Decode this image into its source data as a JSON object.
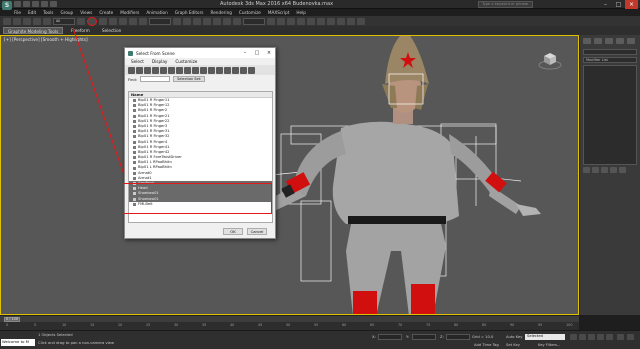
{
  "window": {
    "title": "Autodesk 3ds Max  2016 x64     Budenovka.max",
    "search_placeholder": "Type a keyword or phrase"
  },
  "menu": [
    "File",
    "Edit",
    "Tools",
    "Group",
    "Views",
    "Create",
    "Modifiers",
    "Animation",
    "Graph Editors",
    "Rendering",
    "Customize",
    "MAXScript",
    "Help"
  ],
  "toolbar": {
    "selection_filter": "All"
  },
  "ribbon": {
    "tabs": [
      "Graphite Modeling Tools",
      "Freeform",
      "Selection"
    ]
  },
  "viewport": {
    "label": "[+] [Perspective] [Smooth + Highlights]"
  },
  "command_panel": {
    "modifier_list": "Modifier List"
  },
  "dialog": {
    "title": "Select From Scene",
    "menu": [
      "Select",
      "Display",
      "Customize"
    ],
    "find_label": "Find:",
    "selection_set_label": "Selection Set:",
    "column_header": "Name",
    "items": [
      "Bip01 R Finger11",
      "Bip01 R Finger12",
      "Bip01 R Finger2",
      "Bip01 R Finger21",
      "Bip01 R Finger22",
      "Bip01 R Finger3",
      "Bip01 R Finger31",
      "Bip01 R Finger32",
      "Bip01 R Finger4",
      "Bip01 R Finger41",
      "Bip01 R Finger42",
      "Bip01 R ForeTwistDriver",
      "Bip01 L RPaoBhitn",
      "Bip01 L RPaoBhitn",
      "Armat0",
      "Armat1",
      "Armfinot",
      "Head",
      "Shoebeo01",
      "Shoebeo01",
      "FMLBelt"
    ],
    "selected_indices": [
      16,
      17,
      18,
      19
    ],
    "ok_label": "OK",
    "cancel_label": "Cancel"
  },
  "timeline": {
    "slider_label": "0 / 100",
    "ticks": [
      "0",
      "5",
      "10",
      "15",
      "20",
      "25",
      "30",
      "35",
      "40",
      "45",
      "50",
      "55",
      "60",
      "65",
      "70",
      "75",
      "80",
      "85",
      "90",
      "95",
      "100"
    ]
  },
  "status": {
    "maxscript": "Welcome to M",
    "selection_info": "1 Objects Selected",
    "prompt": "Click and drag to pan a non-camera view",
    "x_label": "X:",
    "y_label": "Y:",
    "z_label": "Z:",
    "grid": "Grid = 10.0",
    "autokey": "Auto Key",
    "set_key": "Set Key",
    "key_filters": "Key Filters...",
    "selected_combo": "Selected",
    "add_time_tag": "Add Time Tag"
  }
}
